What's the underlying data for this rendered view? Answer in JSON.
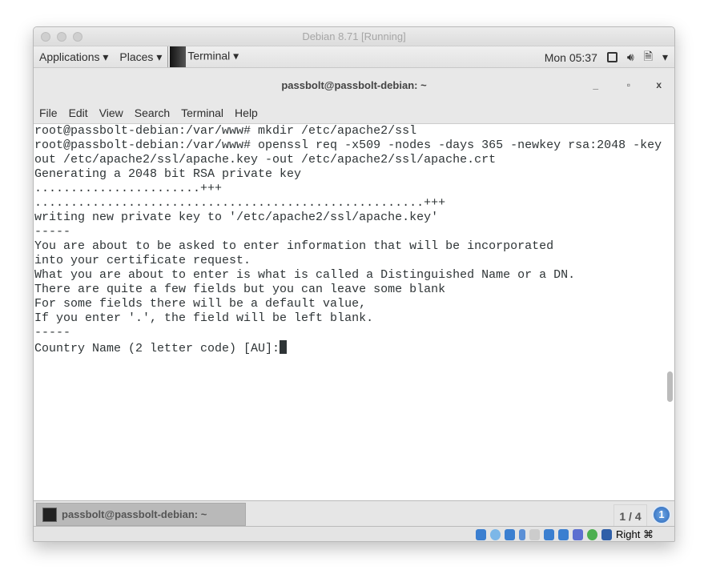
{
  "vm_window": {
    "title": "Debian 8.71 [Running]"
  },
  "gnome_bar": {
    "applications": "Applications ▾",
    "places": "Places ▾",
    "terminal": "Terminal ▾",
    "clock": "Mon 05:37",
    "menu_arrow": "▾"
  },
  "terminal_window": {
    "title": "passbolt@passbolt-debian: ~",
    "minimize": "_",
    "maximize": "▫",
    "close": "x"
  },
  "menu": [
    "File",
    "Edit",
    "View",
    "Search",
    "Terminal",
    "Help"
  ],
  "terminal": {
    "lines": [
      "root@passbolt-debian:/var/www# mkdir /etc/apache2/ssl",
      "root@passbolt-debian:/var/www# openssl req -x509 -nodes -days 365 -newkey rsa:2048 -key",
      "out /etc/apache2/ssl/apache.key -out /etc/apache2/ssl/apache.crt",
      "Generating a 2048 bit RSA private key",
      ".......................+++",
      "......................................................+++",
      "writing new private key to '/etc/apache2/ssl/apache.key'",
      "-----",
      "You are about to be asked to enter information that will be incorporated",
      "into your certificate request.",
      "What you are about to enter is what is called a Distinguished Name or a DN.",
      "There are quite a few fields but you can leave some blank",
      "For some fields there will be a default value,",
      "If you enter '.', the field will be left blank.",
      "-----"
    ],
    "prompt": "Country Name (2 letter code) [AU]:"
  },
  "taskbar": {
    "item": "passbolt@passbolt-debian: ~",
    "pager": "1 / 4",
    "workspace": "1"
  },
  "statusbar": {
    "host_key": "Right ⌘"
  }
}
